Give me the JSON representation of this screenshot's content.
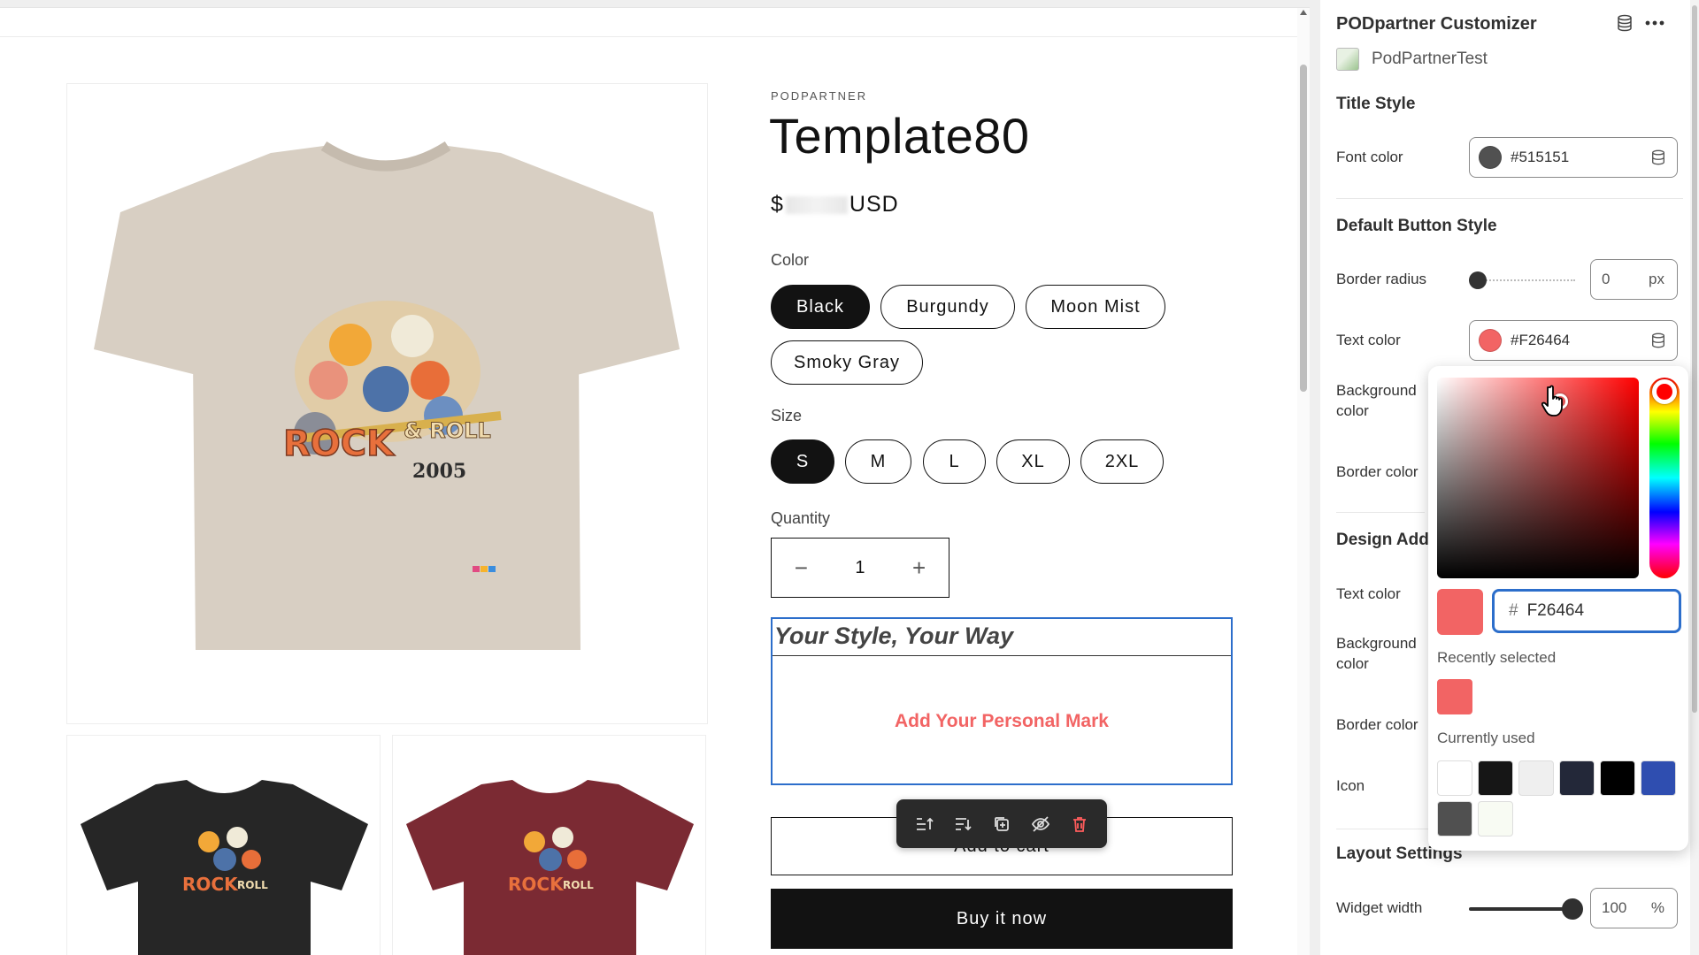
{
  "product": {
    "vendor": "PODPARTNER",
    "title": "Template80",
    "price_prefix": "$",
    "price_suffix": "USD",
    "color_label": "Color",
    "colors": [
      "Black",
      "Burgundy",
      "Moon Mist",
      "Smoky Gray"
    ],
    "selected_color": "Black",
    "size_label": "Size",
    "sizes": [
      "S",
      "M",
      "L",
      "XL",
      "2XL"
    ],
    "selected_size": "S",
    "quantity_label": "Quantity",
    "quantity": "1",
    "quantity_minus": "−",
    "quantity_plus": "+",
    "personal_mark_title": "Your Style, Your Way",
    "personal_mark_button": "Add Your Personal Mark",
    "add_to_cart": "Add to cart",
    "buy_now": "Buy it now",
    "thumbnails": [
      "black-tshirt",
      "burgundy-tshirt"
    ],
    "tshirt_color_main": "#d8cfc3",
    "tshirt_color_black": "#262626",
    "tshirt_color_burgundy": "#7b2a33",
    "print_text": "ROCK",
    "print_text2": "& ROLL",
    "print_year": "2005"
  },
  "panel": {
    "title": "PODpartner Customizer",
    "store": "PodPartnerTest",
    "title_style": "Title Style",
    "font_color_label": "Font color",
    "font_color": "#515151",
    "default_button_style": "Default Button Style",
    "border_radius_label": "Border radius",
    "border_radius_value": "0",
    "border_radius_unit": "px",
    "text_color_label": "Text color",
    "text_color": "#F26464",
    "background_color_label": "Background color",
    "border_color_label": "Border color",
    "design_add_section": "Design Add",
    "design_text_color_label": "Text color",
    "design_background_color_label": "Background color",
    "design_border_color_label": "Border color",
    "icon_label": "Icon",
    "layout_settings": "Layout Settings",
    "widget_width_label": "Widget width",
    "widget_width_value": "100",
    "widget_width_unit": "%"
  },
  "picker": {
    "hash": "#",
    "hex": "F26464",
    "recently_selected_label": "Recently selected",
    "recently_selected": [
      "#f26464"
    ],
    "currently_used_label": "Currently used",
    "currently_used": [
      "#ffffff",
      "#161616",
      "#efefef",
      "#232839",
      "#000000",
      "#2f4eb0",
      "#505050",
      "#f8fbf3"
    ]
  },
  "colors": {
    "accent_blue": "#2c6ecb",
    "personal_mark_red": "#f26464",
    "dark": "#121212"
  }
}
